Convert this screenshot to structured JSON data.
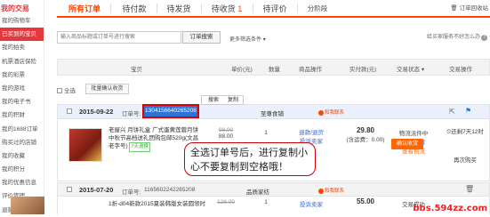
{
  "sidebar": {
    "title": "我的交易",
    "items": [
      {
        "label": "我的购物车",
        "active": false
      },
      {
        "label": "已买到的宝贝",
        "active": true
      },
      {
        "label": "我的拍卖",
        "active": false
      },
      {
        "label": "机票酒店保险",
        "active": false
      },
      {
        "label": "我的彩票",
        "active": false
      },
      {
        "label": "我的游戏",
        "active": false
      },
      {
        "label": "我的电子书",
        "active": false
      },
      {
        "label": "我的积财",
        "active": false
      },
      {
        "label": "我的1688订单",
        "active": false
      },
      {
        "label": "购买过的店铺",
        "active": false
      },
      {
        "label": "我的收藏",
        "active": false
      },
      {
        "label": "我的积分",
        "active": false
      },
      {
        "label": "我的优惠信息",
        "active": false
      },
      {
        "label": "评价管理",
        "active": false
      },
      {
        "label": "退款维权",
        "active": false
      }
    ]
  },
  "tabs": [
    {
      "label": "所有订单",
      "count": "",
      "active": true
    },
    {
      "label": "待付款",
      "count": "",
      "active": false
    },
    {
      "label": "待发货",
      "count": "",
      "active": false
    },
    {
      "label": "待收货",
      "count": "1",
      "active": false
    },
    {
      "label": "待评价",
      "count": "",
      "active": false
    },
    {
      "label": "分阶段",
      "count": "",
      "active": false
    }
  ],
  "recycle_label": "订单回收站",
  "search": {
    "placeholder": "输入商品标题或订单号进行搜索",
    "button": "订单搜索",
    "more": "更多筛选条件",
    "help": "给买家服务不好怎么办"
  },
  "table_header": {
    "item": "宝贝",
    "price": "单价(元)",
    "qty": "数量",
    "ops": "商品操作",
    "paid": "实付款(元)",
    "status": "交易状态",
    "actions": "交易操作"
  },
  "select_all": "全选",
  "batch_confirm": "批量确认收货",
  "context_menu": {
    "search": "搜索",
    "copy": "复制"
  },
  "orders": [
    {
      "date": "2015-09-22",
      "order_label": "订单号:",
      "order_number": "1304156640265208",
      "shop": "至尊食铺",
      "badge": "和我联系",
      "title": "老屋兴 月饼礼盒 广式蛋黄莲蓉月饼 中秋节高档送礼团购包邮520g(文昌老字号)",
      "tag": "7天退换",
      "orig_price": "98.00",
      "price": "88.00",
      "qty": "1",
      "ops": "退款/退货",
      "ops2": "投诉卖家",
      "paid": "29.80",
      "shipping": "(含运费：0.00)",
      "status1": "物流派件中",
      "status2": "订单详情",
      "status3": "查看物流",
      "countdown": "还剩7天12时",
      "confirm_btn": "确认收货",
      "extend": "再次购买"
    },
    {
      "date": "2015-07-20",
      "order_label": "订单号:",
      "order_number": "1165602242265208",
      "shop": "品质家纺",
      "badge": "和我联系",
      "title": "1折-d04新款2015夏装韩版女装圆领时",
      "orig_price": "128.00",
      "price": "55.00",
      "qty": "1",
      "ops": "投诉卖家",
      "paid": "55.00",
      "status1": "交易成功"
    }
  ],
  "callout": "全选订单号后，进行复制小心不要复制到空格哦！",
  "watermark": "bbs.594zz.com",
  "colors": {
    "accent": "#ff4400",
    "sidebar_active": "#e4393c",
    "selection": "#2b74d6",
    "highlight_border": "#e00000"
  }
}
